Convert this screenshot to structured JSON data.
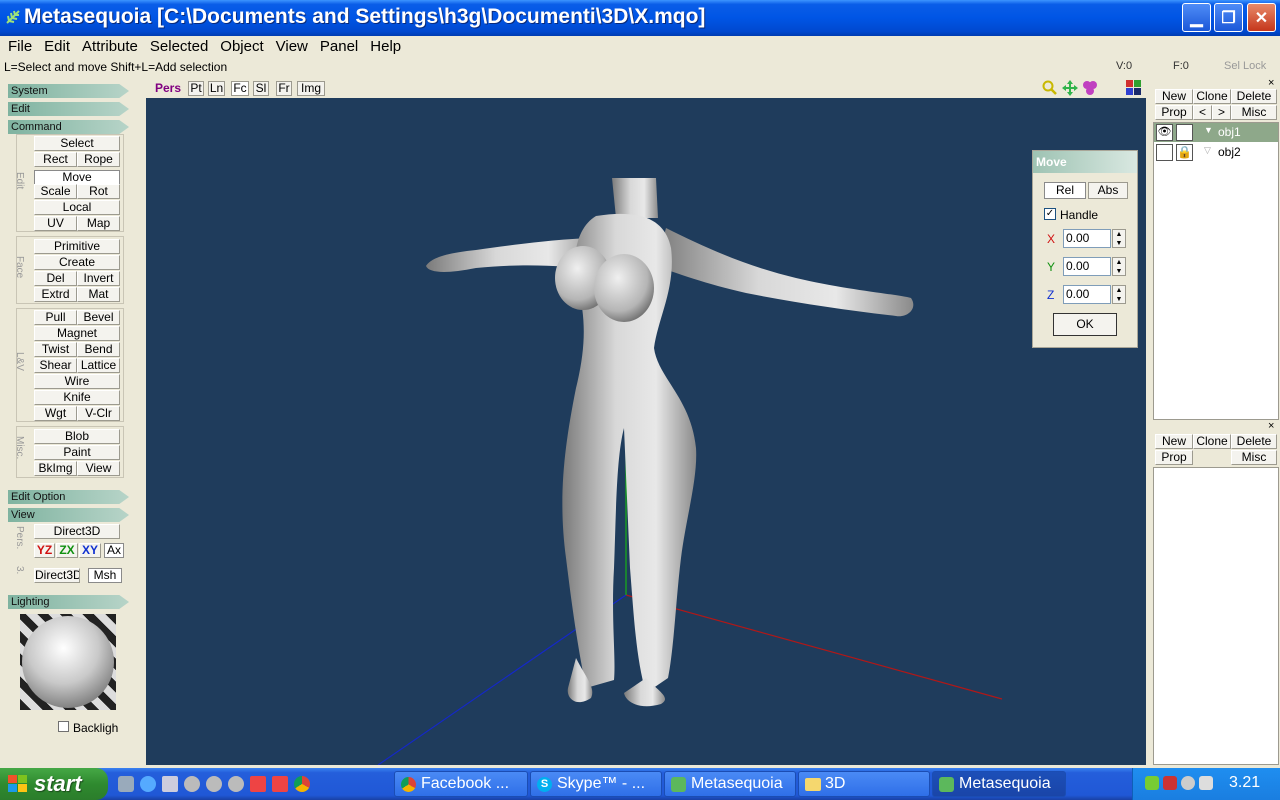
{
  "window": {
    "title": "Metasequoia [C:\\Documents and Settings\\h3g\\Documenti\\3D\\X.mqo]",
    "min_glyph": "▁",
    "max_glyph": "❐",
    "close_glyph": "✕"
  },
  "menu": [
    "File",
    "Edit",
    "Attribute",
    "Selected",
    "Object",
    "View",
    "Panel",
    "Help"
  ],
  "status": {
    "hint": "L=Select and move  Shift+L=Add selection",
    "vertices": "V:0",
    "faces": "F:0",
    "sel_lock": "Sel Lock"
  },
  "left_panel": {
    "sections": {
      "system": "System",
      "edit": "Edit",
      "command": "Command",
      "edit_option": "Edit Option",
      "view": "View",
      "lighting": "Lighting"
    },
    "groups": {
      "edit": "Edit",
      "face": "Face",
      "lv": "L&V",
      "misc": "Misc.",
      "pers": "Pers.",
      "three": "3."
    },
    "buttons": {
      "select": "Select",
      "rect": "Rect",
      "rope": "Rope",
      "move": "Move",
      "scale": "Scale",
      "rot": "Rot",
      "local": "Local",
      "uv": "UV",
      "map": "Map",
      "primitive": "Primitive",
      "create": "Create",
      "del": "Del",
      "invert": "Invert",
      "extrd": "Extrd",
      "mat": "Mat",
      "pull": "Pull",
      "bevel": "Bevel",
      "magnet": "Magnet",
      "twist": "Twist",
      "bend": "Bend",
      "shear": "Shear",
      "lattice": "Lattice",
      "wire": "Wire",
      "knife": "Knife",
      "wgt": "Wgt",
      "vclr": "V-Clr",
      "blob": "Blob",
      "paint": "Paint",
      "bkimg": "BkImg",
      "view": "View",
      "direct3d": "Direct3D",
      "yz": "YZ",
      "zx": "ZX",
      "xy": "XY",
      "ax": "Ax",
      "direct3d_2": "Direct3D",
      "msh": "Msh",
      "backlight": "Backligh"
    }
  },
  "viewport": {
    "tabs": {
      "pers": "Pers",
      "pt": "Pt",
      "ln": "Ln",
      "fc": "Fc",
      "sl": "Sl",
      "fr": "Fr",
      "img": "Img"
    },
    "background": "#1f3c5c"
  },
  "move_dialog": {
    "title": "Move",
    "rel": "Rel",
    "abs": "Abs",
    "handle": "Handle",
    "x_label": "X",
    "y_label": "Y",
    "z_label": "Z",
    "x_value": "0.00",
    "y_value": "0.00",
    "z_value": "0.00",
    "ok": "OK"
  },
  "object_panel": {
    "new": "New",
    "clone": "Clone",
    "delete": "Delete",
    "prop": "Prop",
    "lt": "<",
    "gt": ">",
    "misc": "Misc",
    "objects": [
      "obj1",
      "obj2"
    ]
  },
  "material_panel": {
    "new": "New",
    "clone": "Clone",
    "delete": "Delete",
    "prop": "Prop",
    "misc": "Misc"
  },
  "taskbar": {
    "start": "start",
    "tasks": [
      "Facebook ...",
      "Skype™ - ...",
      "Metasequoia",
      "3D",
      "Metasequoia"
    ],
    "clock": "3.21"
  }
}
